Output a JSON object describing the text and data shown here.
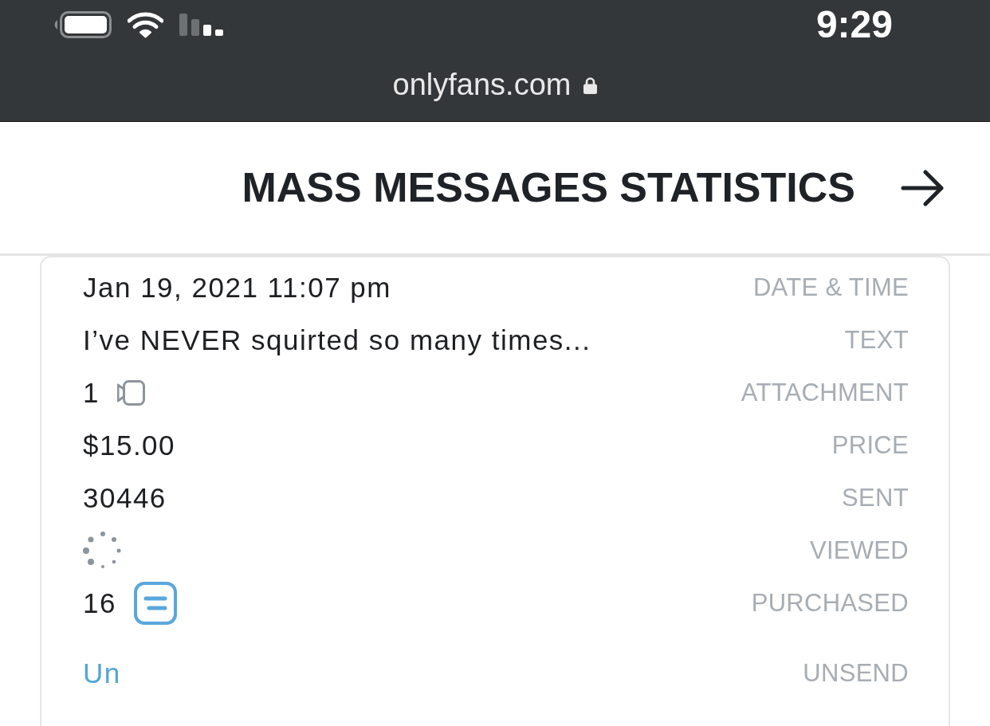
{
  "status_bar": {
    "time": "9:29"
  },
  "address_bar": {
    "url": "onlyfans.com"
  },
  "header": {
    "title": "MASS MESSAGES STATISTICS"
  },
  "stats": [
    {
      "kind": "text",
      "label": "DATE & TIME",
      "value": "Jan 19, 2021 11:07 pm"
    },
    {
      "kind": "text",
      "label": "TEXT",
      "value": "I’ve NEVER squirted so many times..."
    },
    {
      "kind": "attachment",
      "label": "ATTACHMENT",
      "value": "1"
    },
    {
      "kind": "text",
      "label": "PRICE",
      "value": "$15.00"
    },
    {
      "kind": "text",
      "label": "SENT",
      "value": "30446"
    },
    {
      "kind": "loading",
      "label": "VIEWED"
    },
    {
      "kind": "purchases",
      "label": "PURCHASED",
      "value": "16"
    },
    {
      "kind": "link",
      "label": "UNSEND",
      "value": "Un"
    }
  ]
}
